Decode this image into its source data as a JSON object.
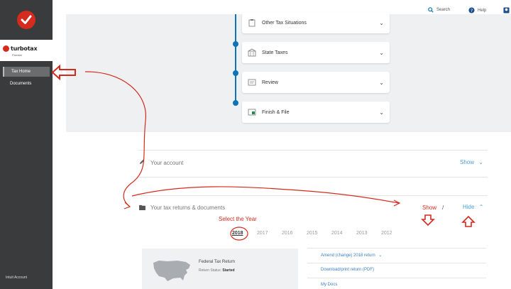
{
  "sidebar": {
    "brand_name": "turbotax",
    "brand_sub": "Premier",
    "items": [
      {
        "label": "Tax Home",
        "active": true
      },
      {
        "label": "Documents",
        "active": false
      }
    ],
    "footer": "Intuit Account"
  },
  "topbar": {
    "search_label": "Search",
    "help_label": "Help"
  },
  "steps": [
    {
      "label": "Other Tax Situations",
      "icon": "clipboard-icon"
    },
    {
      "label": "State Taxes",
      "icon": "building-icon"
    },
    {
      "label": "Review",
      "icon": "review-icon"
    },
    {
      "label": "Finish & File",
      "icon": "file-icon"
    }
  ],
  "account": {
    "title": "Your account",
    "toggle": "Show"
  },
  "returns": {
    "title": "Your tax returns & documents",
    "show": "Show",
    "separator": "/",
    "hide": "Hide",
    "annotation": "Select the Year",
    "years": [
      "2018",
      "2017",
      "2016",
      "2015",
      "2014",
      "2013",
      "2012"
    ],
    "selected_year": "2018",
    "federal": {
      "title": "Federal Tax Return",
      "status_label": "Return Status:",
      "status_value": "Started"
    },
    "actions": [
      "Amend (change) 2018 return",
      "Download/print return (PDF)",
      "My Docs"
    ]
  },
  "colors": {
    "sidebar": "#3a3b3d",
    "accent": "#0d74b5",
    "annotation": "#d42a1e",
    "link": "#4a9ed6"
  }
}
